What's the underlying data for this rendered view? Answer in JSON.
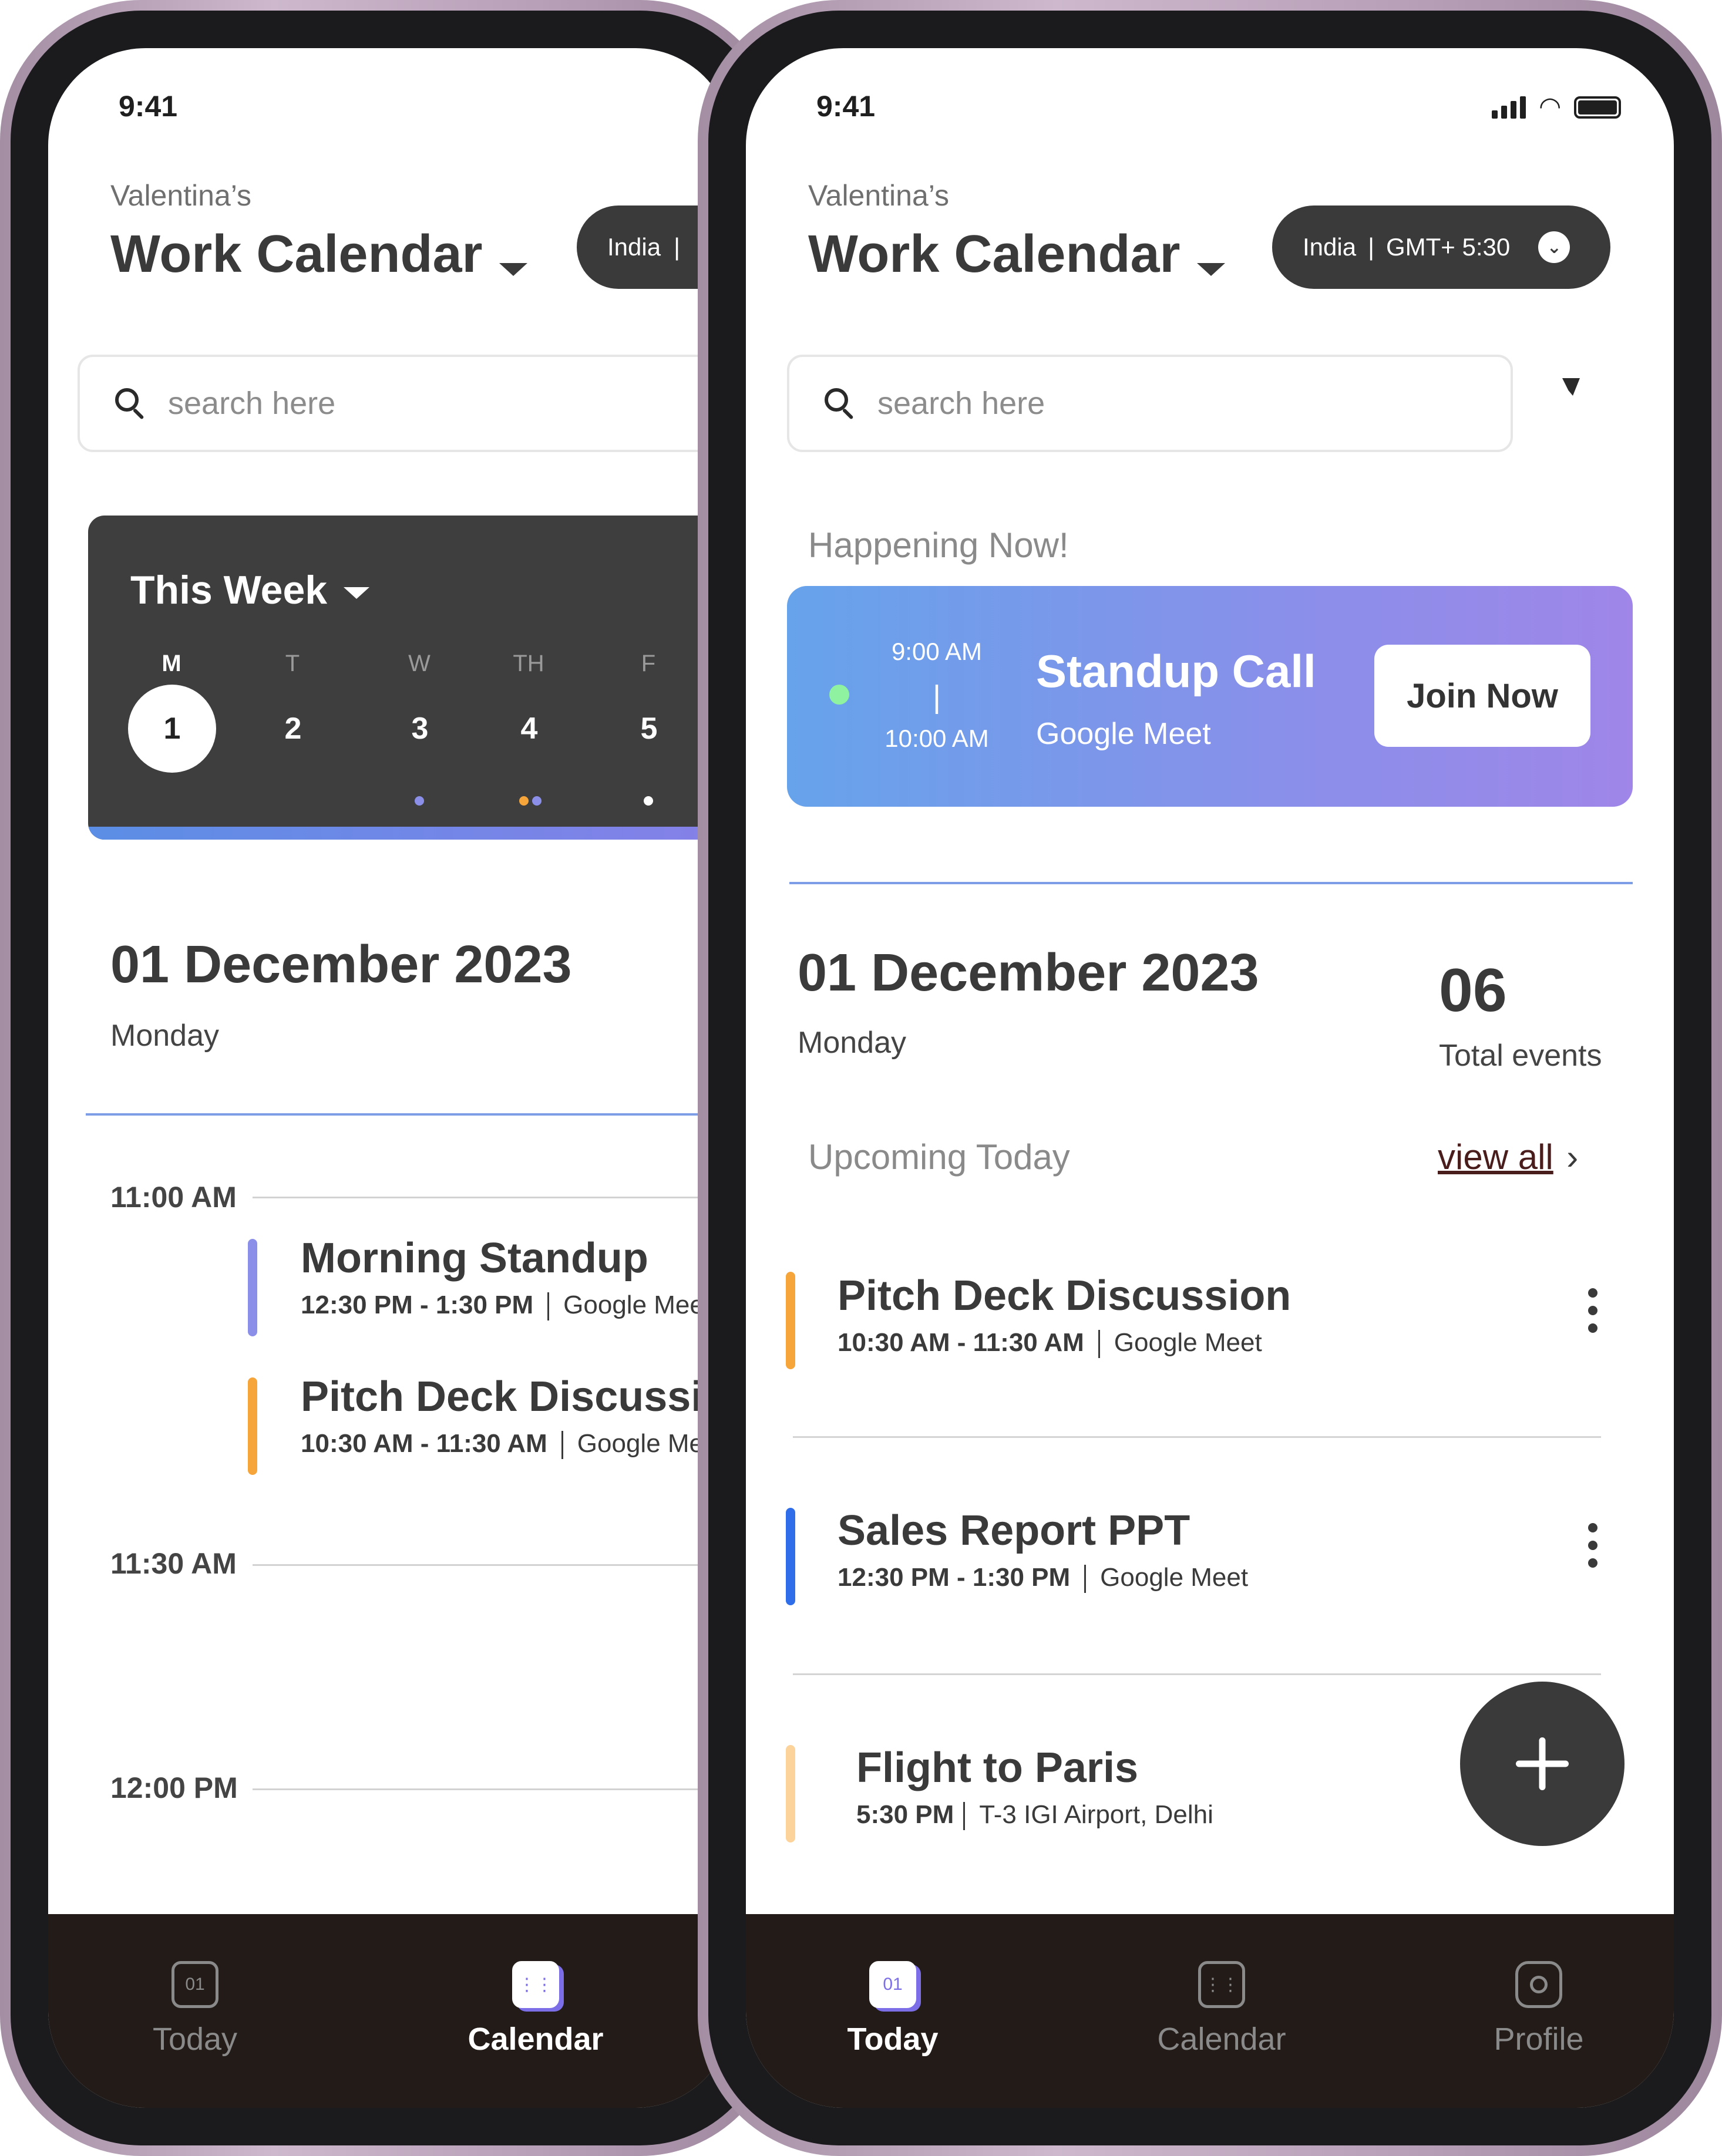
{
  "status": {
    "time": "9:41"
  },
  "header": {
    "owner": "Valentina’s",
    "title": "Work Calendar",
    "timezone_country": "India",
    "timezone_sep": "|",
    "timezone_offset": "GMT+ 5:30"
  },
  "search": {
    "placeholder": "search here"
  },
  "week": {
    "title": "This Week",
    "days": [
      {
        "dow": "M",
        "num": "1"
      },
      {
        "dow": "T",
        "num": "2"
      },
      {
        "dow": "W",
        "num": "3"
      },
      {
        "dow": "TH",
        "num": "4"
      },
      {
        "dow": "F",
        "num": "5"
      }
    ]
  },
  "date": {
    "full": "01 December 2023",
    "weekday": "Monday"
  },
  "schedule": {
    "slots": [
      "11:00 AM",
      "11:30 AM",
      "12:00 PM"
    ],
    "events": [
      {
        "title": "Morning Standup",
        "time": "12:30 PM - 1:30 PM",
        "location": "Google Meet",
        "color": "#8b8fe8"
      },
      {
        "title": "Pitch Deck Discussion",
        "time": "10:30 AM - 11:30 AM",
        "location": "Google Meet",
        "color": "#f6a53b"
      }
    ]
  },
  "now": {
    "label": "Happening Now!",
    "start": "9:00 AM",
    "divider": "|",
    "end": "10:00 AM",
    "title": "Standup Call",
    "platform": "Google Meet",
    "join_label": "Join Now"
  },
  "summary": {
    "count": "06",
    "count_label": "Total events"
  },
  "upcoming": {
    "label": "Upcoming Today",
    "view_all": "view all",
    "view_all_chevron": "›",
    "events": [
      {
        "title": "Pitch Deck Discussion",
        "time": "10:30 AM - 11:30 AM",
        "location": "Google Meet",
        "color": "#f6a53b"
      },
      {
        "title": "Sales Report PPT",
        "time": "12:30 PM - 1:30 PM",
        "location": "Google Meet",
        "color": "#2f6ee8"
      },
      {
        "title": "Flight to Paris",
        "time": "5:30 PM",
        "location": "T-3 IGI Airport, Delhi",
        "color": "#fcd39a"
      }
    ]
  },
  "nav": {
    "today": "Today",
    "calendar": "Calendar",
    "profile": "Profile",
    "today_icon_text": "01"
  },
  "colors": {
    "accent_blue": "#7d9ee6",
    "card_dark": "#3e3e3e",
    "nav_bg": "#231b18",
    "active_indicator": "#7b6ee6"
  }
}
